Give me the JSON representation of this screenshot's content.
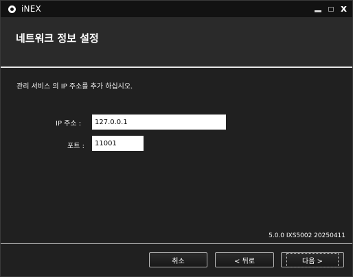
{
  "window": {
    "title": "iNEX"
  },
  "header": {
    "title": "네트워크 정보 설정"
  },
  "content": {
    "instruction": "관리 서비스 의 IP 주소를 추가 하십시오.",
    "ip_label": "IP 주소 :",
    "ip_value": "127.0.0.1",
    "port_label": "포트 :",
    "port_value": "11001",
    "version": "5.0.0 IXS5002 20250411"
  },
  "buttons": {
    "cancel": "취소",
    "back": "< 뒤로",
    "next": "다음 >"
  }
}
